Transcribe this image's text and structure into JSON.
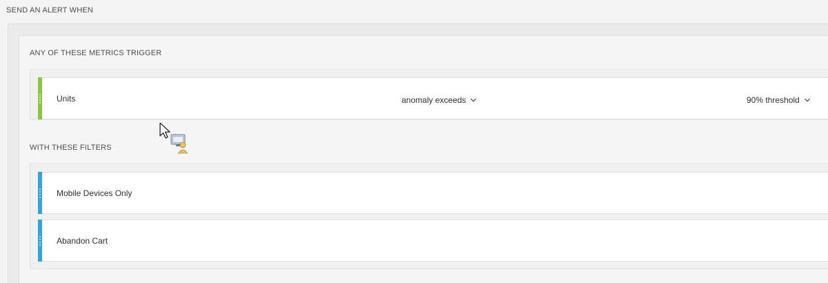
{
  "header": {
    "title": "SEND AN ALERT WHEN"
  },
  "metrics": {
    "label": "ANY OF THESE METRICS TRIGGER",
    "items": [
      {
        "name": "Units",
        "condition": "anomaly exceeds",
        "threshold": "90% threshold",
        "accent_color": "#8cc63f"
      }
    ]
  },
  "filters": {
    "label": "WITH THESE FILTERS",
    "items": [
      {
        "name": "Mobile Devices Only",
        "accent_color": "#2fa3de"
      },
      {
        "name": "Abandon Cart",
        "accent_color": "#2fa3de"
      }
    ]
  },
  "icons": {
    "drag_handle": "drag-handle-icon",
    "dropdown": "chevron-down-icon",
    "cursor": "mouse-pointer-icon",
    "overlay": "screen-share-icon"
  }
}
